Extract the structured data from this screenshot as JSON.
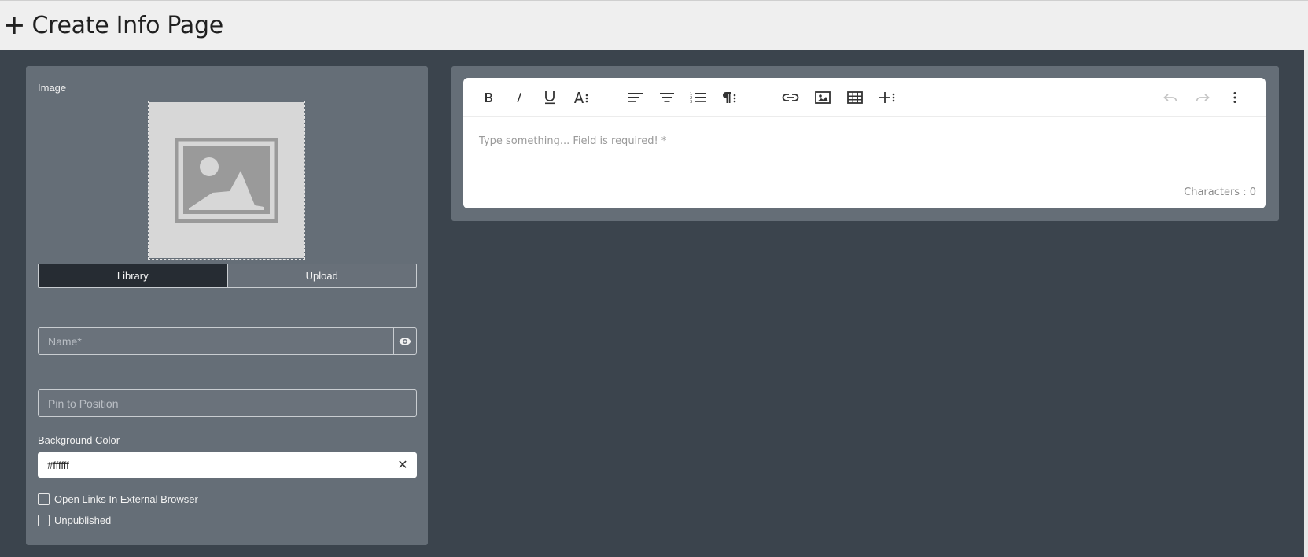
{
  "header": {
    "plus_icon": "+",
    "title": "Create Info Page"
  },
  "form": {
    "image_label": "Image",
    "image_icon": "image-placeholder-icon",
    "library_label": "Library",
    "upload_label": "Upload",
    "name_placeholder": "Name*",
    "name_value": "",
    "pin_placeholder": "Pin to Position",
    "pin_value": "",
    "background_color_label": "Background Color",
    "background_color_value": "#ffffff",
    "clear_icon": "✕",
    "open_links_label": "Open Links In External Browser",
    "unpublished_label": "Unpublished"
  },
  "editor": {
    "placeholder": "Type something... Field is required! *",
    "counter": "Characters : 0",
    "toolbar": [
      "bold-icon",
      "italic-icon",
      "underline-icon",
      "font-size-icon",
      "align-left-icon",
      "align-center-icon",
      "list-icon",
      "paragraph-icon",
      "link-icon",
      "image-icon",
      "table-icon",
      "insert-icon",
      "undo-icon",
      "redo-icon",
      "more-icon"
    ]
  },
  "colors": {
    "background": "#3b444d",
    "panel": "#656e77",
    "active_segment": "#262c33",
    "header": "#efefef"
  }
}
